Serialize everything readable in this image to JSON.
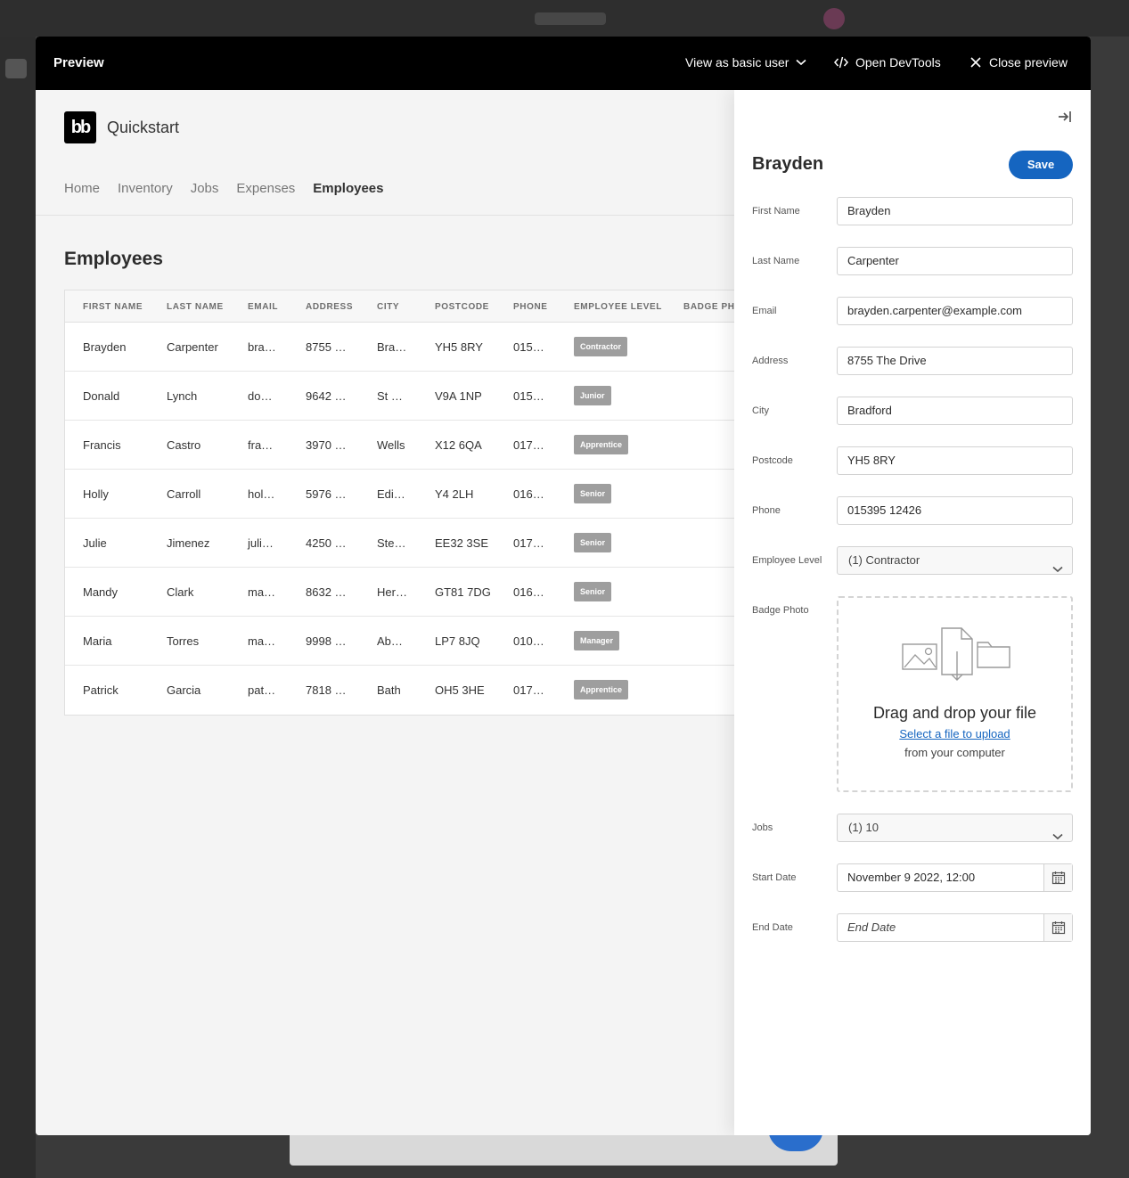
{
  "preview_bar": {
    "title": "Preview",
    "view_as": "View as basic user",
    "devtools": "Open DevTools",
    "close": "Close preview"
  },
  "app": {
    "logo_text": "bb",
    "name": "Quickstart",
    "nav": [
      "Home",
      "Inventory",
      "Jobs",
      "Expenses",
      "Employees"
    ],
    "active_nav": "Employees",
    "page_title": "Employees"
  },
  "table": {
    "columns": [
      "FIRST NAME",
      "LAST NAME",
      "EMAIL",
      "ADDRESS",
      "CITY",
      "POSTCODE",
      "PHONE",
      "EMPLOYEE LEVEL",
      "BADGE PHO"
    ],
    "rows": [
      {
        "first": "Brayden",
        "last": "Carpenter",
        "email": "bra…",
        "address": "8755 …",
        "city": "Bra…",
        "postcode": "YH5 8RY",
        "phone": "015…",
        "level": "Contractor"
      },
      {
        "first": "Donald",
        "last": "Lynch",
        "email": "do…",
        "address": "9642 …",
        "city": "St …",
        "postcode": "V9A 1NP",
        "phone": "015…",
        "level": "Junior"
      },
      {
        "first": "Francis",
        "last": "Castro",
        "email": "fra…",
        "address": "3970 …",
        "city": "Wells",
        "postcode": "X12 6QA",
        "phone": "017…",
        "level": "Apprentice"
      },
      {
        "first": "Holly",
        "last": "Carroll",
        "email": "hol…",
        "address": "5976 …",
        "city": "Edi…",
        "postcode": "Y4 2LH",
        "phone": "016…",
        "level": "Senior"
      },
      {
        "first": "Julie",
        "last": "Jimenez",
        "email": "juli…",
        "address": "4250 …",
        "city": "Ste…",
        "postcode": "EE32 3SE",
        "phone": "017…",
        "level": "Senior"
      },
      {
        "first": "Mandy",
        "last": "Clark",
        "email": "ma…",
        "address": "8632 …",
        "city": "Her…",
        "postcode": "GT81 7DG",
        "phone": "016…",
        "level": "Senior"
      },
      {
        "first": "Maria",
        "last": "Torres",
        "email": "ma…",
        "address": "9998 …",
        "city": "Ab…",
        "postcode": "LP7 8JQ",
        "phone": "010…",
        "level": "Manager"
      },
      {
        "first": "Patrick",
        "last": "Garcia",
        "email": "pat…",
        "address": "7818 …",
        "city": "Bath",
        "postcode": "OH5 3HE",
        "phone": "017…",
        "level": "Apprentice"
      }
    ]
  },
  "panel": {
    "title": "Brayden",
    "save_label": "Save",
    "fields": {
      "first_name": {
        "label": "First Name",
        "value": "Brayden"
      },
      "last_name": {
        "label": "Last Name",
        "value": "Carpenter"
      },
      "email": {
        "label": "Email",
        "value": "brayden.carpenter@example.com"
      },
      "address": {
        "label": "Address",
        "value": "8755 The Drive"
      },
      "city": {
        "label": "City",
        "value": "Bradford"
      },
      "postcode": {
        "label": "Postcode",
        "value": "YH5 8RY"
      },
      "phone": {
        "label": "Phone",
        "value": "015395 12426"
      },
      "employee_level": {
        "label": "Employee Level",
        "value": "(1) Contractor"
      },
      "badge_photo": {
        "label": "Badge Photo"
      },
      "jobs": {
        "label": "Jobs",
        "value": "(1) 10"
      },
      "start_date": {
        "label": "Start Date",
        "value": "November 9 2022, 12:00"
      },
      "end_date": {
        "label": "End Date",
        "placeholder": "End Date"
      }
    },
    "dropzone": {
      "title": "Drag and drop your file",
      "link": "Select a file to upload",
      "sub": "from your computer"
    }
  },
  "colors": {
    "accent": "#1565c0",
    "badge": "#9e9e9e",
    "preview_bar": "#000000"
  }
}
